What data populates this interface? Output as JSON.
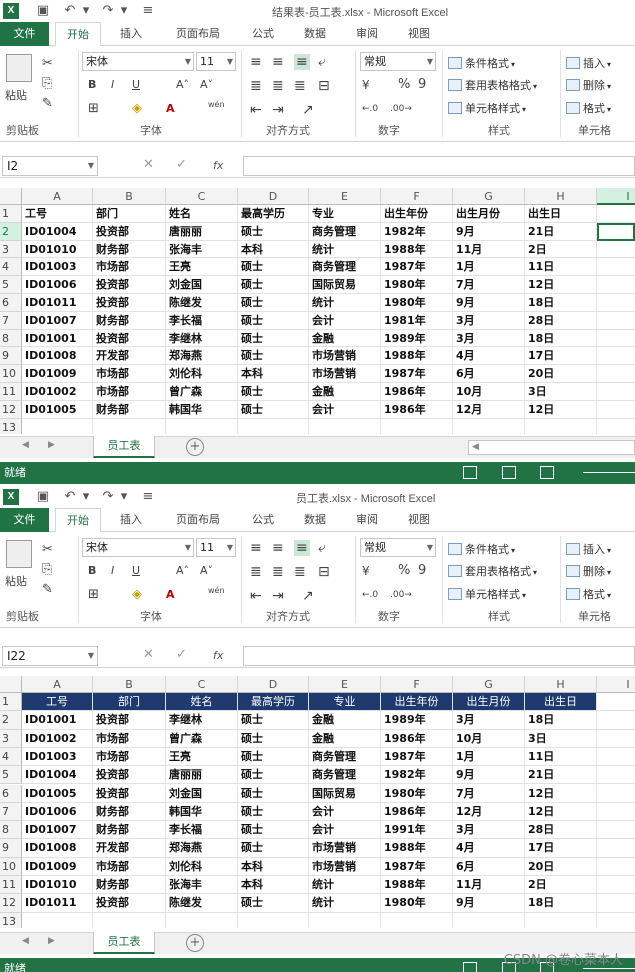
{
  "top_window": {
    "title": "结果表-员工表.xlsx - Microsoft Excel",
    "tabs": [
      "文件",
      "开始",
      "插入",
      "页面布局",
      "公式",
      "数据",
      "审阅",
      "视图"
    ],
    "ribbon": {
      "font_name": "宋体",
      "font_size": "11",
      "number_format": "常规",
      "paste_label": "粘贴",
      "clipboard_label": "剪贴板",
      "font_label": "字体",
      "align_label": "对齐方式",
      "number_label": "数字",
      "styles_label": "样式",
      "cells_label": "单元格",
      "cond_format": "条件格式",
      "table_format": "套用表格格式",
      "cell_style": "单元格样式",
      "insert": "插入",
      "delete": "删除",
      "format": "格式",
      "percent": "%",
      "comma": "9",
      "pinyin": "wén"
    },
    "name_box": "I2",
    "columns": [
      "A",
      "B",
      "C",
      "D",
      "E",
      "F",
      "G",
      "H",
      "I"
    ],
    "rows": [
      [
        "工号",
        "部门",
        "姓名",
        "最高学历",
        "专业",
        "出生年份",
        "出生月份",
        "出生日"
      ],
      [
        "ID01004",
        "投资部",
        "唐丽丽",
        "硕士",
        "商务管理",
        "1982年",
        "9月",
        "21日"
      ],
      [
        "ID01010",
        "财务部",
        "张海丰",
        "本科",
        "统计",
        "1988年",
        "11月",
        "2日"
      ],
      [
        "ID01003",
        "市场部",
        "王亮",
        "硕士",
        "商务管理",
        "1987年",
        "1月",
        "11日"
      ],
      [
        "ID01006",
        "投资部",
        "刘金国",
        "硕士",
        "国际贸易",
        "1980年",
        "7月",
        "12日"
      ],
      [
        "ID01011",
        "投资部",
        "陈继发",
        "硕士",
        "统计",
        "1980年",
        "9月",
        "18日"
      ],
      [
        "ID01007",
        "财务部",
        "李长福",
        "硕士",
        "会计",
        "1981年",
        "3月",
        "28日"
      ],
      [
        "ID01001",
        "投资部",
        "李继林",
        "硕士",
        "金融",
        "1989年",
        "3月",
        "18日"
      ],
      [
        "ID01008",
        "开发部",
        "郑海燕",
        "硕士",
        "市场营销",
        "1988年",
        "4月",
        "17日"
      ],
      [
        "ID01009",
        "市场部",
        "刘伦科",
        "本科",
        "市场营销",
        "1987年",
        "6月",
        "20日"
      ],
      [
        "ID01002",
        "市场部",
        "曾广森",
        "硕士",
        "金融",
        "1986年",
        "10月",
        "3日"
      ],
      [
        "ID01005",
        "财务部",
        "韩国华",
        "硕士",
        "会计",
        "1986年",
        "12月",
        "12日"
      ]
    ],
    "row_numbers": [
      "1",
      "2",
      "3",
      "4",
      "5",
      "6",
      "7",
      "8",
      "9",
      "10",
      "11",
      "12",
      "13"
    ],
    "sheet_tab": "员工表",
    "status": "就绪"
  },
  "bottom_window": {
    "title": "员工表.xlsx - Microsoft Excel",
    "tabs": [
      "文件",
      "开始",
      "插入",
      "页面布局",
      "公式",
      "数据",
      "审阅",
      "视图"
    ],
    "ribbon": {
      "font_name": "宋体",
      "font_size": "11",
      "number_format": "常规",
      "paste_label": "粘贴",
      "clipboard_label": "剪贴板",
      "font_label": "字体",
      "align_label": "对齐方式",
      "number_label": "数字",
      "styles_label": "样式",
      "cells_label": "单元格",
      "cond_format": "条件格式",
      "table_format": "套用表格格式",
      "cell_style": "单元格样式",
      "insert": "插入",
      "delete": "删除",
      "format": "格式",
      "percent": "%",
      "comma": "9",
      "pinyin": "wén"
    },
    "name_box": "I22",
    "columns": [
      "A",
      "B",
      "C",
      "D",
      "E",
      "F",
      "G",
      "H",
      "I"
    ],
    "rows": [
      [
        "工号",
        "部门",
        "姓名",
        "最高学历",
        "专业",
        "出生年份",
        "出生月份",
        "出生日"
      ],
      [
        "ID01001",
        "投资部",
        "李继林",
        "硕士",
        "金融",
        "1989年",
        "3月",
        "18日"
      ],
      [
        "ID01002",
        "市场部",
        "曾广森",
        "硕士",
        "金融",
        "1986年",
        "10月",
        "3日"
      ],
      [
        "ID01003",
        "市场部",
        "王亮",
        "硕士",
        "商务管理",
        "1987年",
        "1月",
        "11日"
      ],
      [
        "ID01004",
        "投资部",
        "唐丽丽",
        "硕士",
        "商务管理",
        "1982年",
        "9月",
        "21日"
      ],
      [
        "ID01005",
        "投资部",
        "刘金国",
        "硕士",
        "国际贸易",
        "1980年",
        "7月",
        "12日"
      ],
      [
        "ID01006",
        "财务部",
        "韩国华",
        "硕士",
        "会计",
        "1986年",
        "12月",
        "12日"
      ],
      [
        "ID01007",
        "财务部",
        "李长福",
        "硕士",
        "会计",
        "1991年",
        "3月",
        "28日"
      ],
      [
        "ID01008",
        "开发部",
        "郑海燕",
        "硕士",
        "市场营销",
        "1988年",
        "4月",
        "17日"
      ],
      [
        "ID01009",
        "市场部",
        "刘伦科",
        "本科",
        "市场营销",
        "1987年",
        "6月",
        "20日"
      ],
      [
        "ID01010",
        "财务部",
        "张海丰",
        "本科",
        "统计",
        "1988年",
        "11月",
        "2日"
      ],
      [
        "ID01011",
        "投资部",
        "陈继发",
        "硕士",
        "统计",
        "1980年",
        "9月",
        "18日"
      ]
    ],
    "row_numbers": [
      "1",
      "2",
      "3",
      "4",
      "5",
      "6",
      "7",
      "8",
      "9",
      "10",
      "11",
      "12",
      "13"
    ],
    "sheet_tab": "员工表",
    "header_color": "#1f3a6e",
    "status": "就绪"
  },
  "watermark": "CSDN @卷心菜本人",
  "accent_color": "#217346"
}
